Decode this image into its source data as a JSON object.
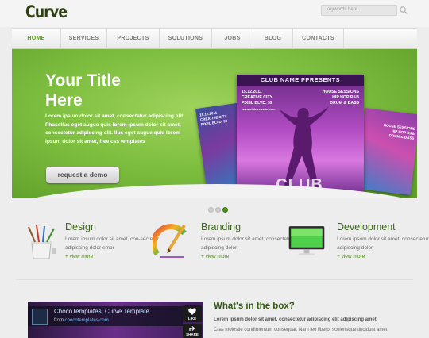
{
  "header": {
    "logo": "Curve",
    "search_placeholder": "keywords here ..."
  },
  "nav": {
    "items": [
      {
        "label": "HOME",
        "active": true
      },
      {
        "label": "SERVICES"
      },
      {
        "label": "PROJECTS"
      },
      {
        "label": "SOLUTIONS"
      },
      {
        "label": "JOBS"
      },
      {
        "label": "BLOG"
      },
      {
        "label": "CONTACTS"
      }
    ]
  },
  "hero": {
    "title_line1": "Your Title",
    "title_line2": "Here",
    "text": "Lorem ipsum dolor sit amet, consectetur adipiscing elit. Phasellus eget augue quis lorem ipsum dolor sit amet, consectetur adipiscing elit. Ilus eget augue quis lorem ipsum dolor sit amet, free css templates",
    "button_label": "request a demo",
    "flyer": {
      "header": "CLUB NAME PPRESENTS",
      "left_lines": [
        "15.12.2011",
        "CREATIVE CITY",
        "PIXEL BLVD. 99",
        "www.clubwebsite.com"
      ],
      "right_lines": [
        "HOUSE SESSIONS",
        "HIP HOP R&B",
        "DRUM & BASS"
      ],
      "name_text": "CLUB"
    },
    "side_left_lines": [
      "15.12.2011",
      "CREATIVE CITY",
      "PIXEL BLVD. 99"
    ],
    "side_right_lines": [
      "HOUSE SESSIONS",
      "HIP HOP R&B",
      "DRUM & BASS"
    ]
  },
  "slider": {
    "count": 3,
    "active_index": 2
  },
  "features": [
    {
      "title": "Design",
      "text": "Lorem ipsum dolor sit amet, con-sectetur adipiscing dolor emor",
      "link": "view more",
      "icon": "paint-brushes-icon"
    },
    {
      "title": "Branding",
      "text": "Lorem ipsum dolor sit amet, consectetur adipiscing dolor",
      "link": "view more",
      "icon": "color-wheel-pencil-icon"
    },
    {
      "title": "Development",
      "text": "Lorem ipsum dolor sit amet, consectetur adipiscing dolor",
      "link": "view more",
      "icon": "monitor-icon"
    }
  ],
  "video": {
    "title": "ChocoTemplates: Curve Template",
    "from_label": "from",
    "from_site": "chocotemplates.com",
    "like_label": "LIKE",
    "share_label": "SHARE"
  },
  "box": {
    "title": "What's in the box?",
    "bold_text": "Lorem ipsum dolor sit amet, consectetur adipiscing elit adipiscing amet",
    "text": "Cras molestie condimentum consequat. Nam leo libero, scelerisque tincidunt amet"
  },
  "colors": {
    "accent_green": "#5d9b25",
    "hero_green": "#7fbf40",
    "heading_green": "#3a6b13"
  }
}
